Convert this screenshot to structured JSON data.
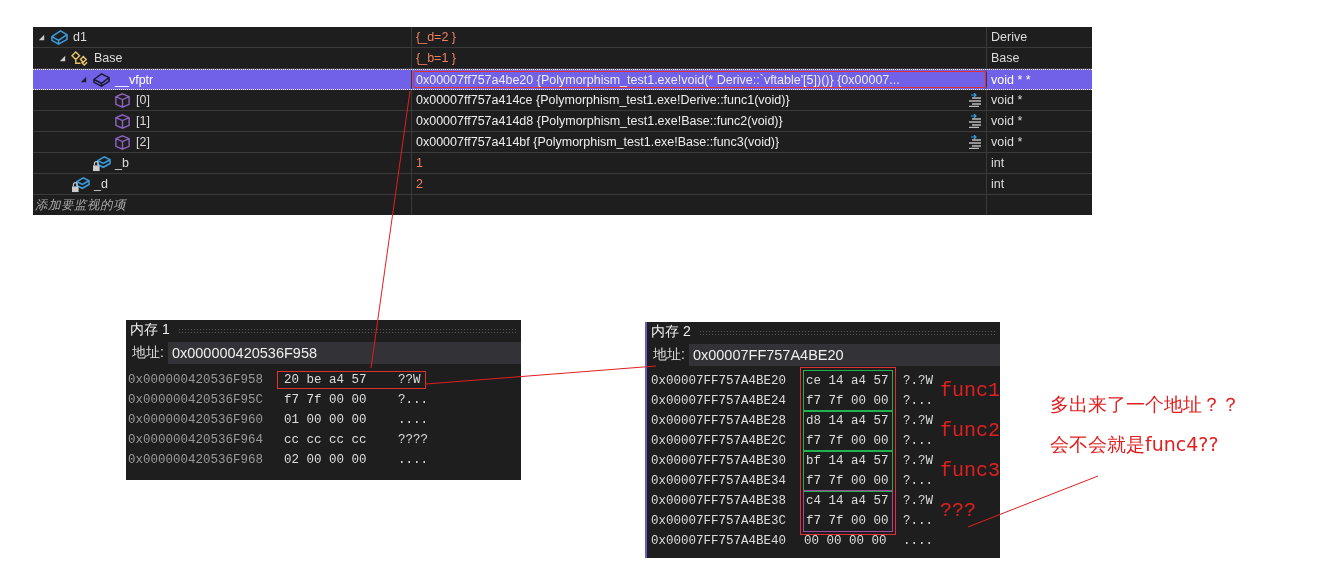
{
  "watch": {
    "items": [
      {
        "name": "d1",
        "kind": "class",
        "value": "{_d=2 }",
        "type": "Derive",
        "changed": true,
        "selected": false,
        "highlighted": false,
        "expanded": true,
        "children": [
          {
            "name": "Base",
            "kind": "base",
            "value": "{_b=1 }",
            "type": "Base",
            "changed": true,
            "selected": false,
            "highlighted": false,
            "expanded": true,
            "children": [
              {
                "name": "__vfptr",
                "kind": "pointer",
                "value": "0x00007ff757a4be20 {Polymorphism_test1.exe!void(* Derive::`vftable'[5])()} {0x00007...",
                "type": "void * *",
                "changed": false,
                "selected": true,
                "highlighted": true,
                "expanded": true,
                "children": [
                  {
                    "name": "[0]",
                    "kind": "element",
                    "value": "0x00007ff757a414ce {Polymorphism_test1.exe!Derive::func1(void)}",
                    "type": "void *",
                    "changed": false,
                    "selected": false,
                    "highlighted": false
                  },
                  {
                    "name": "[1]",
                    "kind": "element",
                    "value": "0x00007ff757a414d8 {Polymorphism_test1.exe!Base::func2(void)}",
                    "type": "void *",
                    "changed": false,
                    "selected": false,
                    "highlighted": false
                  },
                  {
                    "name": "[2]",
                    "kind": "element",
                    "value": "0x00007ff757a414bf {Polymorphism_test1.exe!Base::func3(void)}",
                    "type": "void *",
                    "changed": false,
                    "selected": false,
                    "highlighted": false
                  }
                ]
              },
              {
                "name": "_b",
                "kind": "field",
                "value": "1",
                "type": "int",
                "changed": true,
                "selected": false,
                "highlighted": false
              }
            ]
          },
          {
            "name": "_d",
            "kind": "field",
            "value": "2",
            "type": "int",
            "changed": true,
            "selected": false,
            "highlighted": false
          }
        ]
      }
    ],
    "add_item_hint": "添加要监视的项"
  },
  "memory1": {
    "title": "内存 1",
    "address_label": "地址:",
    "address": "0x000000420536F958",
    "rows": [
      {
        "address": "0x000000420536F958",
        "bytes": "20 be a4 57",
        "chars": "??W",
        "highlighted": true
      },
      {
        "address": "0x000000420536F95C",
        "bytes": "f7 7f 00 00",
        "chars": "?...",
        "highlighted": false
      },
      {
        "address": "0x000000420536F960",
        "bytes": "01 00 00 00",
        "chars": "....",
        "highlighted": false
      },
      {
        "address": "0x000000420536F964",
        "bytes": "cc cc cc cc",
        "chars": "????",
        "highlighted": false
      },
      {
        "address": "0x000000420536F968",
        "bytes": "02 00 00 00",
        "chars": "....",
        "highlighted": false
      }
    ]
  },
  "memory2": {
    "title": "内存 2",
    "address_label": "地址:",
    "address": "0x00007FF757A4BE20",
    "groups": [
      {
        "label": "func1",
        "color": "#22b14c",
        "rows": [
          {
            "address": "0x00007FF757A4BE20",
            "bytes": "ce 14 a4 57",
            "chars": "?.?W"
          },
          {
            "address": "0x00007FF757A4BE24",
            "bytes": "f7 7f 00 00",
            "chars": "?..."
          }
        ]
      },
      {
        "label": "func2",
        "color": "#22b14c",
        "rows": [
          {
            "address": "0x00007FF757A4BE28",
            "bytes": "d8 14 a4 57",
            "chars": "?.?W"
          },
          {
            "address": "0x00007FF757A4BE2C",
            "bytes": "f7 7f 00 00",
            "chars": "?..."
          }
        ]
      },
      {
        "label": "func3",
        "color": "#22b14c",
        "rows": [
          {
            "address": "0x00007FF757A4BE30",
            "bytes": "bf 14 a4 57",
            "chars": "?.?W"
          },
          {
            "address": "0x00007FF757A4BE34",
            "bytes": "f7 7f 00 00",
            "chars": "?..."
          }
        ]
      },
      {
        "label": "???",
        "color": "#a349a4",
        "rows": [
          {
            "address": "0x00007FF757A4BE38",
            "bytes": "c4 14 a4 57",
            "chars": "?.?W"
          },
          {
            "address": "0x00007FF757A4BE3C",
            "bytes": "f7 7f 00 00",
            "chars": "?..."
          }
        ]
      }
    ],
    "rows": [
      {
        "address": "0x00007FF757A4BE40",
        "bytes": "00 00 00 00",
        "chars": "...."
      }
    ]
  },
  "note": [
    "多出来了一个地址？？",
    "会不会就是func4??"
  ]
}
